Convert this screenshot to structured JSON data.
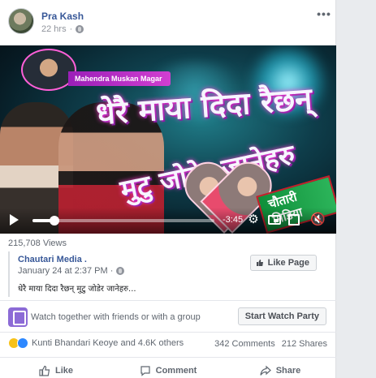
{
  "post": {
    "author": "Pra Kash",
    "time": "22 hrs",
    "privacy_icon": "globe-icon",
    "more_label": "•••"
  },
  "video": {
    "channel_label": "Mahendra Muskan Magar",
    "title_line1": "धेरै माया दिदा रैछन्",
    "title_line2": "मुटु जोडेर जानेहरु",
    "brand_tag": "चौतारी मिडिया",
    "remaining_time": "-3:45",
    "progress_fraction": 0.12,
    "icons": {
      "play": "play-icon",
      "settings": "gear-icon",
      "pip": "picture-in-picture-icon",
      "fullscreen": "fullscreen-icon",
      "mute": "mute-icon"
    }
  },
  "views": "215,708 Views",
  "shared": {
    "source_name": "Chautari Media .",
    "source_time": "January 24 at 2:37 PM ·",
    "like_page_label": "Like Page",
    "caption": "धेरै माया दिदा रैछन् मुटु जोडेर जानेहरु..."
  },
  "watch_party": {
    "text": "Watch together with friends or with a group",
    "button_label": "Start Watch Party"
  },
  "reactions": {
    "text": "Kunti Bhandari Keoye and 4.6K others",
    "comments": "342 Comments",
    "shares": "212 Shares"
  },
  "actions": {
    "like": "Like",
    "comment": "Comment",
    "share": "Share"
  },
  "colors": {
    "link_blue": "#385898",
    "like_blue": "#2d88ff",
    "watch_purple": "#8c6bd6"
  }
}
